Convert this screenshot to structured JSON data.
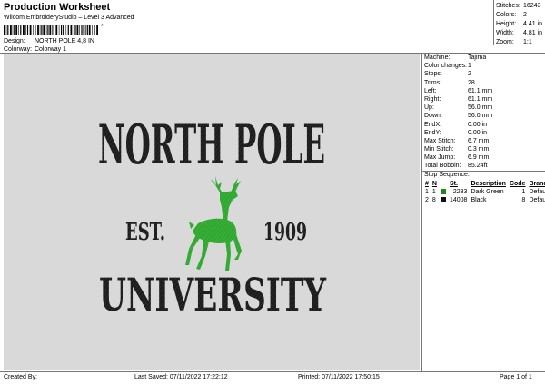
{
  "header": {
    "title": "Production Worksheet",
    "subtitle": "Wilcom EmbroideryStudio – Level 3 Advanced",
    "barcode_text": "*"
  },
  "design": {
    "label": "Design:",
    "value": "NORTH POLE 4,8 IN"
  },
  "colorway": {
    "label": "Colorway:",
    "value": "Colorway 1"
  },
  "top_stats": [
    {
      "label": "Stitches:",
      "value": "16243"
    },
    {
      "label": "Colors:",
      "value": "2"
    },
    {
      "label": "Height:",
      "value": "4.41 in"
    },
    {
      "label": "Width:",
      "value": "4.81 in"
    },
    {
      "label": "Zoom:",
      "value": "1:1"
    }
  ],
  "machine_stats": [
    {
      "label": "Machine:",
      "value": "Tajima"
    },
    {
      "label": "Color changes:",
      "value": "1"
    },
    {
      "label": "Stops:",
      "value": "2"
    },
    {
      "label": "Trims:",
      "value": "28"
    },
    {
      "label": "Left:",
      "value": "61.1 mm"
    },
    {
      "label": "Right:",
      "value": "61.1 mm"
    },
    {
      "label": "Up:",
      "value": "56.0 mm"
    },
    {
      "label": "Down:",
      "value": "56.0 mm"
    },
    {
      "label": "EndX:",
      "value": "0.00 in"
    },
    {
      "label": "EndY:",
      "value": "0.00 in"
    },
    {
      "label": "Max Stitch:",
      "value": "6.7 mm"
    },
    {
      "label": "Min Stitch:",
      "value": "0.3 mm"
    },
    {
      "label": "Max Jump:",
      "value": "6.9 mm"
    },
    {
      "label": "Total Bobbin:",
      "value": "85.24ft"
    }
  ],
  "stop_sequence": {
    "label": "Stop Sequence:",
    "columns": [
      "#",
      "N",
      "",
      "St.",
      "Description",
      "Code",
      "Brand"
    ],
    "rows": [
      {
        "num": "1",
        "needle": "1",
        "color": "#1e8a1e",
        "stitches": "2233",
        "description": "Dark Green",
        "code": "1",
        "brand": "Default"
      },
      {
        "num": "2",
        "needle": "8",
        "color": "#111111",
        "stitches": "14008",
        "description": "Black",
        "code": "8",
        "brand": "Default"
      }
    ]
  },
  "artwork": {
    "line1": "NORTH POLE",
    "est": "EST.",
    "year": "1909",
    "line2": "UNIVERSITY",
    "text_color": "#1c1c1c",
    "deer_color": "#2fa82f"
  },
  "footer": {
    "created_by": "Created By:",
    "last_saved": "Last Saved: 07/11/2022 17:22:12",
    "printed": "Printed: 07/11/2022 17:50:15",
    "page": "Page 1 of 1"
  }
}
